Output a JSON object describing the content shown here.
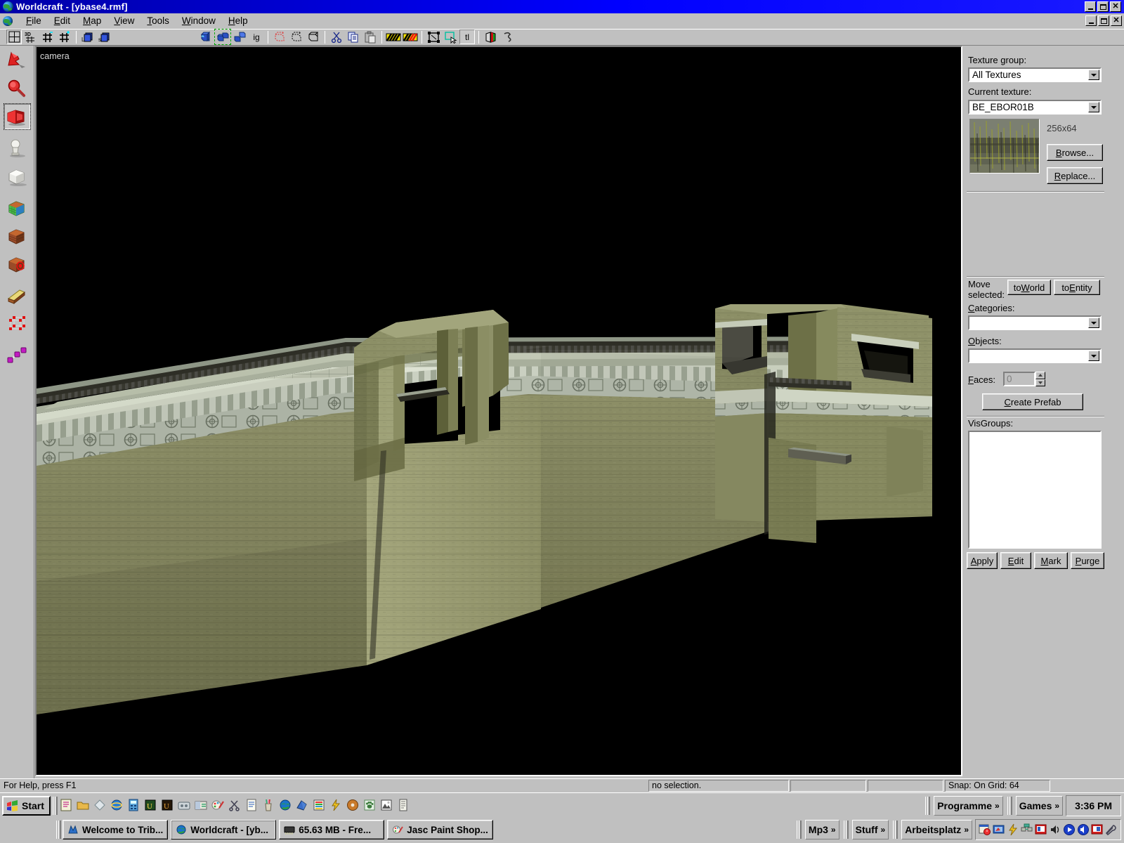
{
  "window": {
    "title": "Worldcraft - [ybase4.rmf]",
    "app_icon": "worldcraft-globe-icon",
    "minimize": "–",
    "maximize": "❐",
    "close": "✕"
  },
  "menu": {
    "items": [
      {
        "label": "File",
        "accel": "F"
      },
      {
        "label": "Edit",
        "accel": "E"
      },
      {
        "label": "Map",
        "accel": "M"
      },
      {
        "label": "View",
        "accel": "V"
      },
      {
        "label": "Tools",
        "accel": "T"
      },
      {
        "label": "Window",
        "accel": "W"
      },
      {
        "label": "Help",
        "accel": "H"
      }
    ]
  },
  "toolbar": {
    "view_buttons": [
      "grid-4view-icon",
      "3d-view-icon",
      "grid-small-icon",
      "grid-large-icon"
    ],
    "object_buttons": [
      "load-prefab-icon",
      "save-prefab-icon"
    ],
    "edit_buttons": [
      "group-icon",
      "ungroup-icon",
      "ignore-group-icon",
      "ig-label"
    ],
    "clip_buttons": [
      "carve-icon",
      "hollow-icon",
      "make-hollow-icon"
    ],
    "clipboard_buttons": [
      "cut-icon",
      "copy-icon",
      "paste-icon"
    ],
    "texture_buttons": [
      "toggle-texture-icon",
      "texture-lock-icon"
    ],
    "select_buttons": [
      "select-all-icon",
      "select-marquee-icon",
      "texture-tool-icon"
    ],
    "misc_buttons": [
      "flip-icon",
      "entity-report-icon"
    ],
    "ig_label": "ig",
    "tl_label": "tl"
  },
  "left_toolbar": {
    "tools": [
      {
        "name": "selection-tool",
        "icon": "red-arrow-icon",
        "selected": false
      },
      {
        "name": "magnify-tool",
        "icon": "red-magnifier-icon",
        "selected": false
      },
      {
        "name": "camera-tool",
        "icon": "red-camera-icon",
        "selected": true
      },
      {
        "name": "entity-tool",
        "icon": "white-entity-icon",
        "selected": false
      },
      {
        "name": "block-tool",
        "icon": "white-cube-icon",
        "selected": false
      },
      {
        "name": "texture-application-tool",
        "icon": "colored-cube-icon",
        "selected": false
      },
      {
        "name": "apply-decals-tool",
        "icon": "brick-cube-icon",
        "selected": false
      },
      {
        "name": "apply-current-texture-tool",
        "icon": "target-cube-icon",
        "selected": false
      },
      {
        "name": "clipping-tool",
        "icon": "clip-wedge-icon",
        "selected": false
      },
      {
        "name": "vertex-manipulation-tool",
        "icon": "vertex-cube-icon",
        "selected": false
      },
      {
        "name": "path-tool",
        "icon": "path-node-icon",
        "selected": false
      }
    ]
  },
  "viewport": {
    "label": "camera",
    "background": "#000000"
  },
  "texture_panel": {
    "group_label": "Texture group:",
    "group_value": "All Textures",
    "current_label": "Current texture:",
    "current_value": "BE_EBOR01B",
    "size": "256x64",
    "browse_label": "Browse...",
    "replace_label": "Replace..."
  },
  "prefab_panel": {
    "move_label_line1": "Move",
    "move_label_line2": "selected:",
    "to_world_label": "toWorld",
    "to_entity_label": "toEntity",
    "categories_label": "Categories:",
    "categories_value": "",
    "objects_label": "Objects:",
    "objects_value": "",
    "faces_label": "Faces:",
    "faces_value": "0",
    "create_prefab_label": "Create Prefab"
  },
  "visgroups_panel": {
    "label": "VisGroups:",
    "items": [],
    "buttons": [
      {
        "label": "Apply",
        "accel": "A"
      },
      {
        "label": "Edit",
        "accel": "E"
      },
      {
        "label": "Mark",
        "accel": "M"
      },
      {
        "label": "Purge",
        "accel": "P"
      }
    ]
  },
  "statusbar": {
    "help_text": "For Help, press F1",
    "selection_text": "no selection.",
    "cell3": "",
    "cell4": "",
    "snap_text": "Snap: On Grid: 64"
  },
  "taskbar": {
    "start_label": "Start",
    "quick_launch": [
      "notepad-icon",
      "folder-open-icon",
      "diamond-icon",
      "internet-explorer-icon",
      "calculator-icon",
      "ultraedit-icon",
      "ultraedit-dark-icon",
      "media-icon",
      "explorer-icon",
      "paintshop-icon",
      "scissors-icon",
      "notes-icon",
      "pencil-cup-icon",
      "worldcraft-globe-icon",
      "3dmodel-icon",
      "list-icon",
      "lightning-icon",
      "cd-icon",
      "paw-icon",
      "photo-icon",
      "document-icon"
    ],
    "tasks": [
      {
        "label": "Welcome to Trib...",
        "icon": "tribes-icon"
      },
      {
        "label": "Worldcraft - [yb...",
        "icon": "worldcraft-globe-icon",
        "active": true
      },
      {
        "label": "65.63 MB - Fre...",
        "icon": "memory-icon"
      },
      {
        "label": "Jasc Paint Shop...",
        "icon": "paintshop-icon"
      }
    ],
    "toolbands_row1": [
      {
        "label": "Programme",
        "chevron": "»"
      },
      {
        "label": "Games",
        "chevron": "»"
      }
    ],
    "toolbands_row2": [
      {
        "label": "Mp3",
        "chevron": "»"
      },
      {
        "label": "Stuff",
        "chevron": "»"
      },
      {
        "label": "Arbeitsplatz",
        "chevron": "»"
      }
    ],
    "clock": "3:36 PM",
    "tray_icons": [
      "scheduler-icon",
      "display-icon",
      "lightning-icon",
      "network-icon",
      "red-monitor-icon",
      "volume-icon",
      "play-blue-icon",
      "sound-blue-icon",
      "red-monitor2-icon",
      "wrench-icon"
    ]
  },
  "colors": {
    "titlebar_start": "#0000a8",
    "titlebar_end": "#1a1aff",
    "face_gray": "#c0c0c0",
    "dark_shadow": "#808080",
    "viewport_bg": "#000000",
    "wall_green": "#8a8b63",
    "wall_green_dark": "#5d6038",
    "wall_top_light": "#b8bba5",
    "trim_gray": "#9ea596",
    "stone_dark": "#3b3b31"
  }
}
